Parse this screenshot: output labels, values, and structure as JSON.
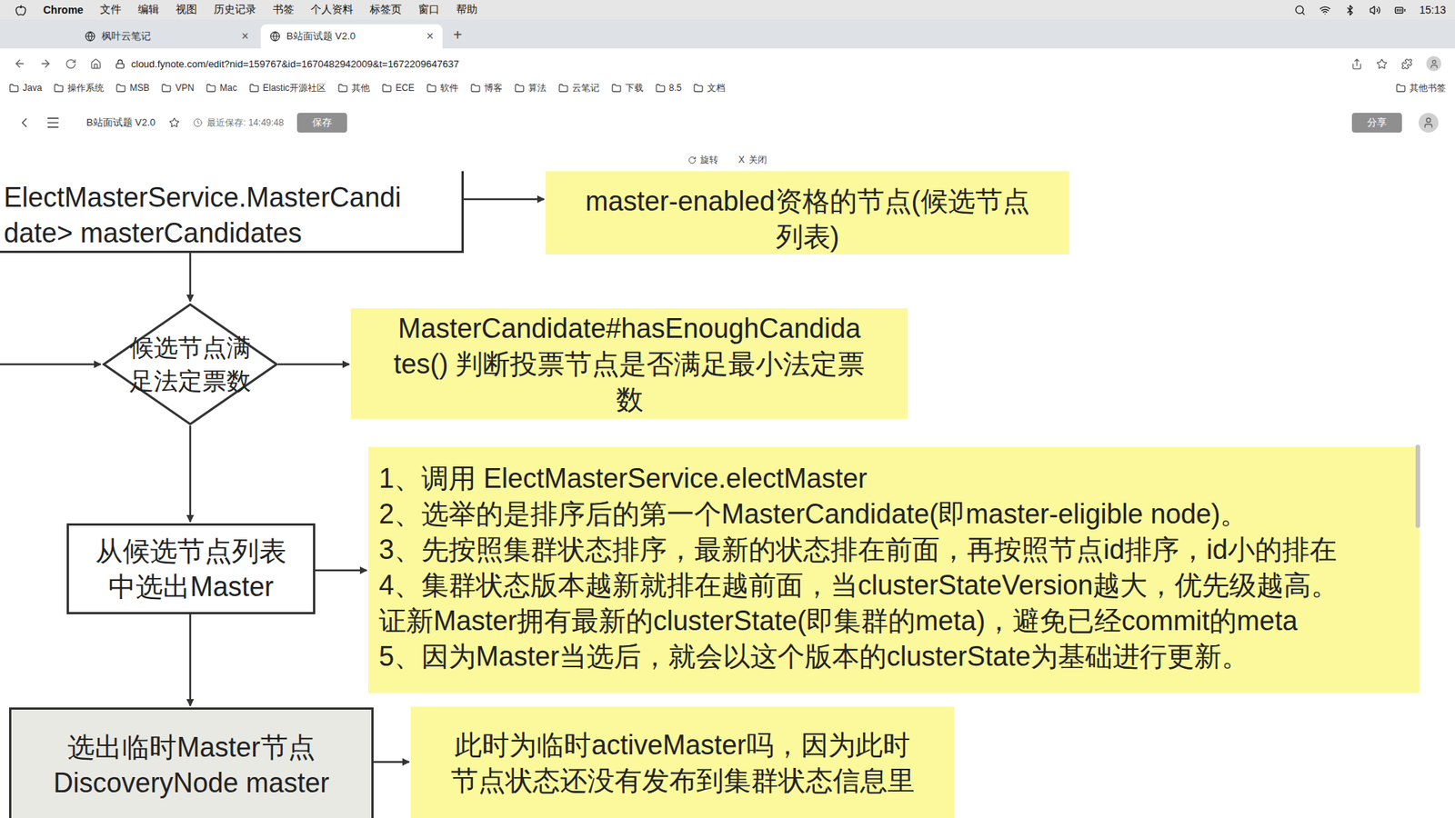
{
  "menu_bar": {
    "app": "Chrome",
    "items": [
      "文件",
      "编辑",
      "视图",
      "历史记录",
      "书签",
      "个人资料",
      "标签页",
      "窗口",
      "帮助"
    ],
    "clock": "15:13"
  },
  "tabs": [
    {
      "label": "枫叶云笔记",
      "selected": false,
      "close": "×"
    },
    {
      "label": "B站面试题 V2.0",
      "selected": true,
      "close": "×"
    }
  ],
  "new_tab": "+",
  "address_bar": {
    "url": "cloud.fynote.com/edit?nid=159767&id=1670482942009&t=1672209647637"
  },
  "bookmarks": [
    "Java",
    "操作系统",
    "MSB",
    "VPN",
    "Mac",
    "Elastic开源社区",
    "其他",
    "ECE",
    "软件",
    "博客",
    "算法",
    "云笔记",
    "下载",
    "8.5",
    "文档"
  ],
  "other_bookmarks": "其他书签",
  "editor_header": {
    "title": "B站面试题 V2.0",
    "last_saved": "最近保存: 14:49:48",
    "save_button": "保存",
    "share_button": "分享"
  },
  "canvas_toolbar": [
    {
      "icon": "",
      "label": "旋转"
    },
    {
      "icon": "X",
      "label": "关闭"
    }
  ],
  "diagram": {
    "nodes": [
      {
        "kind": "process",
        "lines": [
          "ElectMasterService.MasterCandi",
          "date> masterCandidates"
        ]
      },
      {
        "kind": "note",
        "lines": [
          "master-enabled资格的节点(候选节点",
          "列表)"
        ]
      },
      {
        "kind": "decision",
        "lines": [
          "候选节点满",
          "足法定票数"
        ]
      },
      {
        "kind": "note",
        "lines": [
          "MasterCandidate#hasEnoughCandida",
          "tes() 判断投票节点是否满足最小法定票",
          "数"
        ]
      },
      {
        "kind": "process",
        "lines": [
          "从候选节点列表",
          "中选出Master"
        ]
      },
      {
        "kind": "note",
        "lines": [
          "1、调用 ElectMasterService.electMaster",
          "2、选举的是排序后的第一个MasterCandidate(即master-eligible node)。",
          "3、先按照集群状态排序，最新的状态排在前面，再按照节点id排序，id小的排在",
          "4、集群状态版本越新就排在越前面，当clusterStateVersion越大，优先级越高。",
          "证新Master拥有最新的clusterState(即集群的meta)，避免已经commit的meta",
          "5、因为Master当选后，就会以这个版本的clusterState为基础进行更新。"
        ]
      },
      {
        "kind": "terminal",
        "lines": [
          "选出临时Master节点",
          "DiscoveryNode master"
        ]
      },
      {
        "kind": "note",
        "lines": [
          "此时为临时activeMaster吗，因为此时",
          "节点状态还没有发布到集群状态信息里"
        ]
      }
    ]
  }
}
